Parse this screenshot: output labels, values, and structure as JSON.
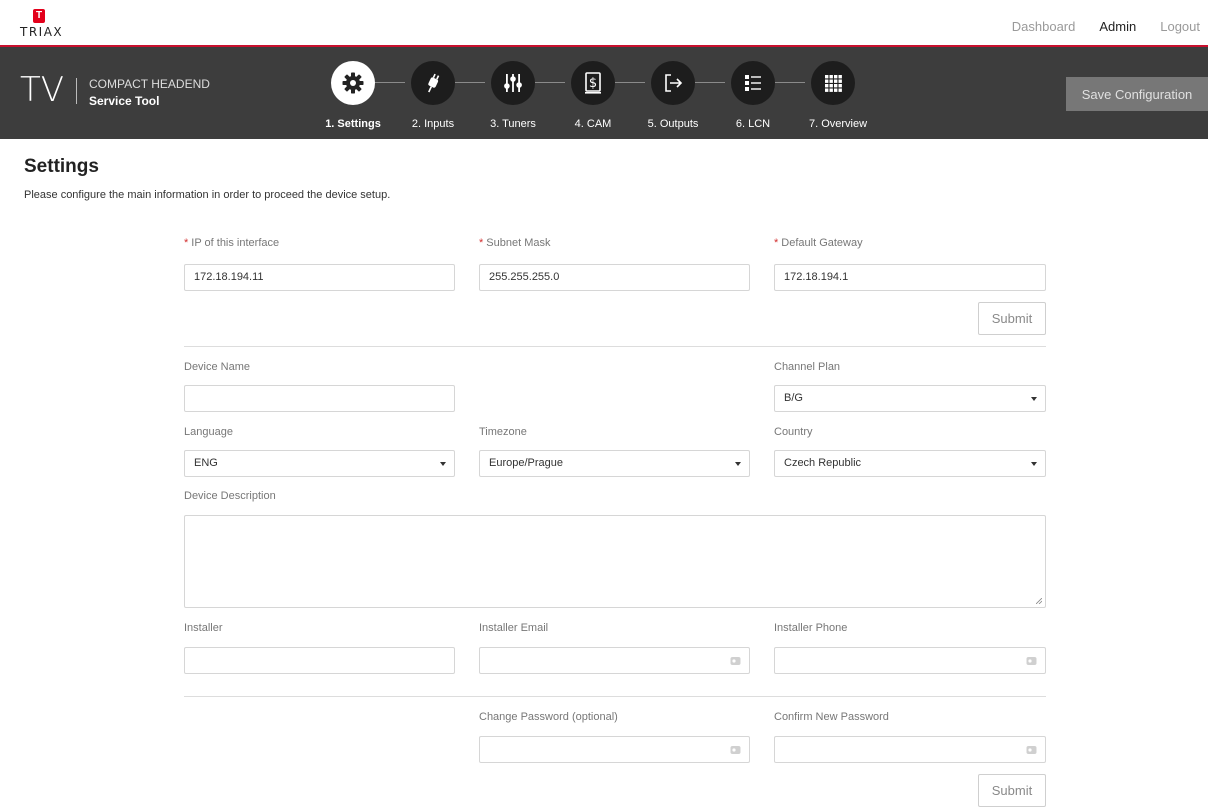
{
  "brand": {
    "logo_letter": "T",
    "logo_text": "TRIAX"
  },
  "topnav": {
    "dashboard": "Dashboard",
    "admin": "Admin",
    "logout": "Logout"
  },
  "header": {
    "tv": "TV",
    "line1": "COMPACT HEADEND",
    "line2": "Service Tool",
    "save_label": "Save Configuration"
  },
  "steps": [
    {
      "label": "1. Settings",
      "icon": "gear-icon",
      "active": true
    },
    {
      "label": "2. Inputs",
      "icon": "plug-icon",
      "active": false
    },
    {
      "label": "3. Tuners",
      "icon": "sliders-icon",
      "active": false
    },
    {
      "label": "4. CAM",
      "icon": "card-icon",
      "active": false
    },
    {
      "label": "5. Outputs",
      "icon": "output-icon",
      "active": false
    },
    {
      "label": "6. LCN",
      "icon": "list-icon",
      "active": false
    },
    {
      "label": "7. Overview",
      "icon": "grid-icon",
      "active": false
    }
  ],
  "page": {
    "title": "Settings",
    "description": "Please configure the main information in order to proceed the device setup."
  },
  "network": {
    "required_mark": "*",
    "ip_label": "IP of this interface",
    "ip_value": "172.18.194.11",
    "subnet_label": "Subnet Mask",
    "subnet_value": "255.255.255.0",
    "gateway_label": "Default Gateway",
    "gateway_value": "172.18.194.1",
    "submit_label": "Submit"
  },
  "device": {
    "name_label": "Device Name",
    "name_value": "",
    "channel_plan_label": "Channel Plan",
    "channel_plan_value": "B/G",
    "language_label": "Language",
    "language_value": "ENG",
    "timezone_label": "Timezone",
    "timezone_value": "Europe/Prague",
    "country_label": "Country",
    "country_value": "Czech Republic",
    "description_label": "Device Description",
    "installer_label": "Installer",
    "installer_email_label": "Installer Email",
    "installer_phone_label": "Installer Phone"
  },
  "password": {
    "change_label": "Change Password (optional)",
    "confirm_label": "Confirm New Password",
    "submit_label": "Submit"
  },
  "colors": {
    "accent_red": "#c8102e",
    "header_bg": "#3d3d3d",
    "required": "#d32f2f"
  }
}
